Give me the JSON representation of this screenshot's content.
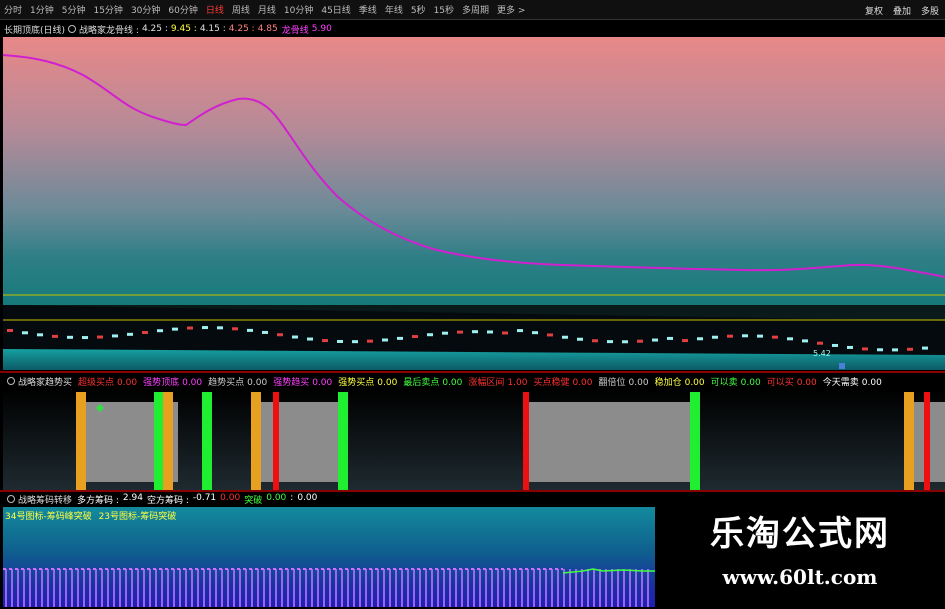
{
  "toolbar": {
    "tabs": [
      {
        "label": "分时",
        "active": false
      },
      {
        "label": "1分钟",
        "active": false
      },
      {
        "label": "5分钟",
        "active": false
      },
      {
        "label": "15分钟",
        "active": false
      },
      {
        "label": "30分钟",
        "active": false
      },
      {
        "label": "60分钟",
        "active": false
      },
      {
        "label": "日线",
        "active": true
      },
      {
        "label": "周线",
        "active": false
      },
      {
        "label": "月线",
        "active": false
      },
      {
        "label": "10分钟",
        "active": false
      },
      {
        "label": "45日线",
        "active": false
      },
      {
        "label": "季线",
        "active": false
      },
      {
        "label": "年线",
        "active": false
      },
      {
        "label": "5秒",
        "active": false
      },
      {
        "label": "15秒",
        "active": false
      },
      {
        "label": "多周期",
        "active": false
      },
      {
        "label": "更多 >",
        "active": false
      }
    ],
    "right": [
      "复权",
      "叠加",
      "多股"
    ]
  },
  "main_info": {
    "title": "长期顶底(日线)",
    "indicator": "战略家龙骨线 :",
    "values": [
      "4.25",
      "9.45",
      "4.15",
      "4.25",
      "4.85"
    ],
    "value_colors": [
      "#e0e0e0",
      "#ffff40",
      "#e0e0e0",
      "#ff8080",
      "#ff8080"
    ],
    "dragon_label": "龙骨线",
    "dragon_value": "5.90"
  },
  "signal_info": {
    "title": "战略家趋势买",
    "items": [
      {
        "label": "超级买点",
        "value": "0.00",
        "label_color": "#ff3030",
        "value_color": "#ff3030"
      },
      {
        "label": "强势顶底",
        "value": "0.00",
        "label_color": "#ff40ff",
        "value_color": "#ff40ff"
      },
      {
        "label": "趋势买点",
        "value": "0.00",
        "label_color": "#cccccc",
        "value_color": "#cccccc"
      },
      {
        "label": "强势趋买",
        "value": "0.00",
        "label_color": "#ff40ff",
        "value_color": "#ff40ff"
      },
      {
        "label": "强势买点",
        "value": "0.00",
        "label_color": "#ffff40",
        "value_color": "#ffff40"
      },
      {
        "label": "最后卖点",
        "value": "0.00",
        "label_color": "#40ff40",
        "value_color": "#40ff40"
      },
      {
        "label": "涨幅区间",
        "value": "1.00",
        "label_color": "#ff3030",
        "value_color": "#ff3030"
      },
      {
        "label": "买点稳健",
        "value": "0.00",
        "label_color": "#ff3030",
        "value_color": "#ff3030"
      },
      {
        "label": "翻倍位",
        "value": "0.00",
        "label_color": "#cccccc",
        "value_color": "#cccccc"
      },
      {
        "label": "稳加仓",
        "value": "0.00",
        "label_color": "#ffff40",
        "value_color": "#ffff40"
      },
      {
        "label": "可以卖",
        "value": "0.00",
        "label_color": "#40ff40",
        "value_color": "#40ff40"
      },
      {
        "label": "可以买",
        "value": "0.00",
        "label_color": "#ff3030",
        "value_color": "#ff3030"
      },
      {
        "label": "今天需卖",
        "value": "0.00",
        "label_color": "#ffffff",
        "value_color": "#ffffff"
      }
    ]
  },
  "chip_info": {
    "title": "战略筹码转移",
    "items": [
      {
        "text": "多方筹码 :",
        "color": "#ffffff"
      },
      {
        "text": "2.94",
        "color": "#ffffff"
      },
      {
        "text": "空方筹码 :",
        "color": "#ffffff"
      },
      {
        "text": "-0.71",
        "color": "#ffffff"
      },
      {
        "text": "0.00",
        "color": "#ff3030"
      },
      {
        "text": "突破",
        "color": "#40ff40"
      },
      {
        "text": "0.00",
        "color": "#40ff40"
      },
      {
        "text": ":",
        "color": "#ffffff"
      },
      {
        "text": "0.00",
        "color": "#ffffff"
      }
    ]
  },
  "bottom_legend": {
    "part1": "34号图标-筹码峰突破",
    "part2": "23号图标-筹码突破",
    "color1": "#ffff40",
    "color2": "#ffff40"
  },
  "price_label": "5.42",
  "watermark": {
    "title": "乐淘公式网",
    "url": "www.60lt.com"
  },
  "colors": {
    "curve": "#d020d0",
    "ref_line": "#c8c000",
    "orange_bar": "#e8a020",
    "green_bar": "#20ee30",
    "red_bar": "#ee1010",
    "gray_band": "#8c8c8c"
  }
}
